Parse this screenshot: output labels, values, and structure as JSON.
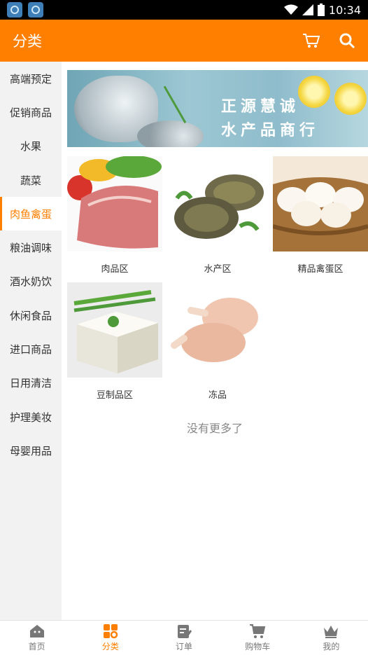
{
  "status_bar": {
    "time": "10:34"
  },
  "header": {
    "title": "分类",
    "icons": [
      "cart-icon",
      "search-icon"
    ]
  },
  "sidebar": {
    "items": [
      {
        "label": "高端预定",
        "active": false
      },
      {
        "label": "促销商品",
        "active": false
      },
      {
        "label": "水果",
        "active": false
      },
      {
        "label": "蔬菜",
        "active": false
      },
      {
        "label": "肉鱼禽蛋",
        "active": true
      },
      {
        "label": "粮油调味",
        "active": false
      },
      {
        "label": "酒水奶饮",
        "active": false
      },
      {
        "label": "休闲食品",
        "active": false
      },
      {
        "label": "进口商品",
        "active": false
      },
      {
        "label": "日用清洁",
        "active": false
      },
      {
        "label": "护理美妆",
        "active": false
      },
      {
        "label": "母婴用品",
        "active": false
      }
    ]
  },
  "banner": {
    "line1": "正源慧诚",
    "line2": "水产品商行"
  },
  "categories": [
    {
      "label": "肉品区"
    },
    {
      "label": "水产区"
    },
    {
      "label": "精品禽蛋区"
    },
    {
      "label": "豆制品区"
    },
    {
      "label": "冻品"
    }
  ],
  "footer_note": "没有更多了",
  "colors": {
    "accent": "#ff7f00",
    "sidebar_bg": "#f2f2f2"
  },
  "tabbar": {
    "items": [
      {
        "label": "首页",
        "icon": "home-icon",
        "active": false
      },
      {
        "label": "分类",
        "icon": "category-grid-icon",
        "active": true
      },
      {
        "label": "订单",
        "icon": "order-icon",
        "active": false
      },
      {
        "label": "购物车",
        "icon": "cart-icon",
        "active": false
      },
      {
        "label": "我的",
        "icon": "crown-icon",
        "active": false
      }
    ]
  }
}
